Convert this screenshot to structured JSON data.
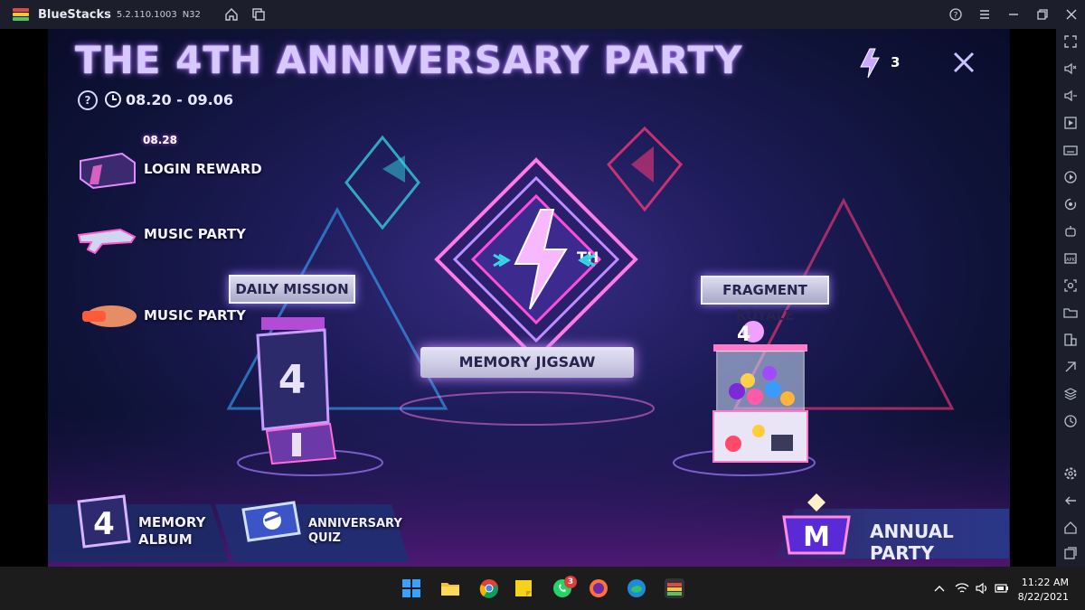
{
  "window": {
    "app_name": "BlueStacks",
    "version": "5.2.110.1003",
    "build": "N32"
  },
  "game": {
    "title": "THE 4TH ANNIVERSARY PARTY",
    "date_range": "08.20 - 09.06",
    "help_label": "?",
    "token_count": "3",
    "menu": [
      {
        "label": "LOGIN REWARD",
        "badge": "08.28"
      },
      {
        "label": "MUSIC PARTY"
      },
      {
        "label": "MUSIC PARTY"
      }
    ],
    "daily_mission": "DAILY MISSION",
    "memory_jigsaw": "MEMORY JIGSAW",
    "fragment_royale": "FRAGMENT ROYALE",
    "center_logo_sub": "TH",
    "memory_album_line1": "MEMORY",
    "memory_album_line2": "ALBUM",
    "quiz_line1": "ANNIVERSARY",
    "quiz_line2": "QUIZ",
    "annual_party": "ANNUAL PARTY"
  },
  "taskbar": {
    "whatsapp_badge": "3",
    "time": "11:22 AM",
    "date": "8/22/2021"
  },
  "colors": {
    "titlebar_bg": "#1c1f2b",
    "taskbar_bg": "#1c1c1c",
    "accent_purple": "#a86bff",
    "neon_pink": "#ff4fd8",
    "neon_cyan": "#3ad6ff"
  }
}
